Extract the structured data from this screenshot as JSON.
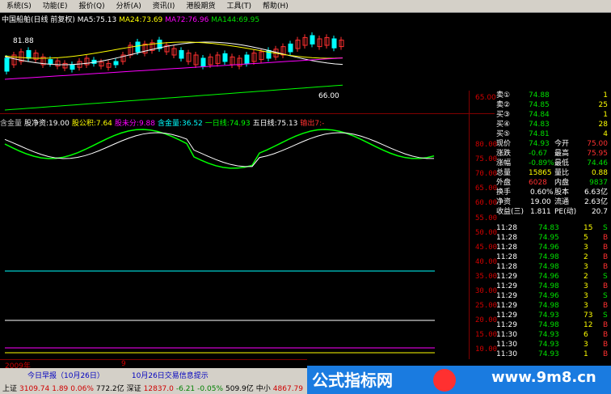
{
  "menubar": [
    "系统(S)",
    "功能(E)",
    "报价(Q)",
    "分析(A)",
    "资讯(I)",
    "港股期货",
    "工具(T)",
    "帮助(H)"
  ],
  "legend": {
    "title": "中国船舶(日线 前复权)",
    "ma5": "MA5:75.13",
    "ma24": "MA24:73.69",
    "ma72": "MA72:76.96",
    "ma144": "MA144:69.95",
    "hi_label": "81.88",
    "lo_label": "66.00",
    "axis_65": "65.00"
  },
  "infobar": [
    {
      "t": "含金量",
      "c": "#c0c0c0"
    },
    {
      "t": "股净资:19.00",
      "c": "#ffffff"
    },
    {
      "t": "股公积:7.64",
      "c": "#ffff00"
    },
    {
      "t": "股未分:9.88",
      "c": "#ff00ff"
    },
    {
      "t": "含金量:36.52",
      "c": "#00ffff"
    },
    {
      "t": "一日线:74.93",
      "c": "#00ff00"
    },
    {
      "t": "五日线:75.13",
      "c": "#ffffff"
    },
    {
      "t": "输出7:-",
      "c": "#ff3030"
    }
  ],
  "axis_labels": [
    "80.00",
    "75.00",
    "70.00",
    "65.00",
    "60.00",
    "55.00",
    "50.00",
    "45.00",
    "40.00",
    "35.00",
    "30.00",
    "25.00",
    "20.00",
    "15.00",
    "10.00"
  ],
  "order_book": {
    "sells": [
      {
        "label": "卖①",
        "price": "74.88",
        "vol": "1"
      },
      {
        "label": "卖②",
        "price": "74.85",
        "vol": "25"
      },
      {
        "label": "买③",
        "price": "74.84",
        "vol": "1"
      },
      {
        "label": "买④",
        "price": "74.83",
        "vol": "28"
      },
      {
        "label": "买⑤",
        "price": "74.81",
        "vol": "4"
      }
    ]
  },
  "quote": [
    {
      "l1": "现价",
      "v1": "74.93",
      "c1": "#00e000",
      "l2": "今开",
      "v2": "75.00",
      "c2": "#ff3030"
    },
    {
      "l1": "涨跌",
      "v1": "-0.67",
      "c1": "#00e000",
      "l2": "最高",
      "v2": "75.95",
      "c2": "#ff3030"
    },
    {
      "l1": "涨幅",
      "v1": "-0.89%",
      "c1": "#00e000",
      "l2": "最低",
      "v2": "74.46",
      "c2": "#00e000"
    },
    {
      "l1": "总量",
      "v1": "15865",
      "c1": "#ffff00",
      "l2": "量比",
      "v2": "0.88",
      "c2": "#ffff00"
    },
    {
      "l1": "外盘",
      "v1": "6028",
      "c1": "#ff3030",
      "l2": "内盘",
      "v2": "9837",
      "c2": "#00e000"
    }
  ],
  "fundamentals": [
    {
      "l1": "换手",
      "v1": "0.60%",
      "l2": "股本",
      "v2": "6.63亿"
    },
    {
      "l1": "净资",
      "v1": "19.00",
      "l2": "流通",
      "v2": "2.63亿"
    },
    {
      "l1": "收益(三)",
      "v1": "1.811",
      "l2": "PE(动)",
      "v2": "20.7"
    }
  ],
  "ticks": [
    {
      "time": "11:28",
      "price": "74.83",
      "vol": "15",
      "side": "S"
    },
    {
      "time": "11:28",
      "price": "74.95",
      "vol": "5",
      "side": "B"
    },
    {
      "time": "11:28",
      "price": "74.96",
      "vol": "3",
      "side": "B"
    },
    {
      "time": "11:28",
      "price": "74.98",
      "vol": "2",
      "side": "B"
    },
    {
      "time": "11:28",
      "price": "74.98",
      "vol": "3",
      "side": "B"
    },
    {
      "time": "11:29",
      "price": "74.96",
      "vol": "2",
      "side": "S"
    },
    {
      "time": "11:29",
      "price": "74.98",
      "vol": "3",
      "side": "B"
    },
    {
      "time": "11:29",
      "price": "74.96",
      "vol": "3",
      "side": "S"
    },
    {
      "time": "11:29",
      "price": "74.98",
      "vol": "3",
      "side": "B"
    },
    {
      "time": "11:29",
      "price": "74.93",
      "vol": "73",
      "side": "S"
    },
    {
      "time": "11:29",
      "price": "74.98",
      "vol": "12",
      "side": "B"
    },
    {
      "time": "11:30",
      "price": "74.93",
      "vol": "6",
      "side": "B"
    },
    {
      "time": "11:30",
      "price": "74.93",
      "vol": "3",
      "side": "B"
    },
    {
      "time": "11:30",
      "price": "74.93",
      "vol": "1",
      "side": "B"
    }
  ],
  "bottom": {
    "year_label": "2009年",
    "month_label": "9",
    "tab1": "今日早报（10月26日）",
    "tab2": "10月26日交易信息提示",
    "status": [
      {
        "t": "上证",
        "c": "#000"
      },
      {
        "t": "3109.74",
        "c": "#d00000"
      },
      {
        "t": "1.89",
        "c": "#d00000"
      },
      {
        "t": "0.06%",
        "c": "#d00000"
      },
      {
        "t": "772.2亿",
        "c": "#000"
      },
      {
        "t": "深证",
        "c": "#000"
      },
      {
        "t": "12837.0",
        "c": "#d00000"
      },
      {
        "t": "-6.21",
        "c": "#008000"
      },
      {
        "t": "-0.05%",
        "c": "#008000"
      },
      {
        "t": "509.9亿",
        "c": "#000"
      },
      {
        "t": "中小",
        "c": "#000"
      },
      {
        "t": "4867.79",
        "c": "#d00000"
      }
    ],
    "banner_text": "公式指标网",
    "banner_url": "www.9m8.cn"
  },
  "colors": {
    "up": "#ff3030",
    "down": "#00ffff",
    "ma5": "#ffffff",
    "ma24": "#ffff00",
    "ma72": "#ff00ff",
    "ma144": "#00ff00"
  }
}
